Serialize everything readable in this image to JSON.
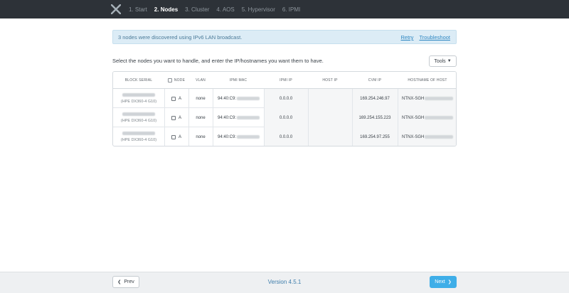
{
  "header": {
    "steps": [
      {
        "label": "1. Start",
        "active": false
      },
      {
        "label": "2. Nodes",
        "active": true
      },
      {
        "label": "3. Cluster",
        "active": false
      },
      {
        "label": "4. AOS",
        "active": false
      },
      {
        "label": "5. Hypervisor",
        "active": false
      },
      {
        "label": "6. IPMI",
        "active": false
      }
    ]
  },
  "banner": {
    "message": "3 nodes were discovered using IPv6 LAN broadcast.",
    "retry_label": "Retry",
    "troubleshoot_label": "Troubleshoot"
  },
  "instruction": "Select the nodes you want to handle, and enter the IP/hostnames you want them to have.",
  "tools_label": "Tools",
  "table": {
    "columns": [
      "BLOCK SERIAL",
      "NODE",
      "VLAN",
      "IPMI MAC",
      "IPMI IP",
      "HOST IP",
      "CVM IP",
      "HOSTNAME OF HOST"
    ],
    "rows": [
      {
        "model": "(HPE DX360-4 G10)",
        "node": "A",
        "vlan": "none",
        "ipmi_mac": "94:40:C9:",
        "ipmi_ip": "0.0.0.0",
        "host_ip": "",
        "cvm_ip": "169.254.246.97",
        "hostname": "NTNX-SGH"
      },
      {
        "model": "(HPE DX360-4 G10)",
        "node": "A",
        "vlan": "none",
        "ipmi_mac": "94:40:C9:",
        "ipmi_ip": "0.0.0.0",
        "host_ip": "",
        "cvm_ip": "169.254.155.223",
        "hostname": "NTNX-SGH"
      },
      {
        "model": "(HPE DX360-4 G10)",
        "node": "A",
        "vlan": "none",
        "ipmi_mac": "94:40:C9:",
        "ipmi_ip": "0.0.0.0",
        "host_ip": "",
        "cvm_ip": "169.254.97.255",
        "hostname": "NTNX-SGH"
      }
    ]
  },
  "footer": {
    "prev_label": "Prev",
    "version": "Version 4.5.1",
    "next_label": "Next"
  },
  "colors": {
    "topbar": "#2d3238",
    "banner_bg": "#dcecf6",
    "link": "#2e87c2",
    "next_button": "#3eaee8"
  },
  "icons": {
    "logo": "nutanix-x-logo",
    "prev": "chevron-left-icon",
    "next": "chevron-right-icon",
    "tools": "chevron-down-icon"
  }
}
